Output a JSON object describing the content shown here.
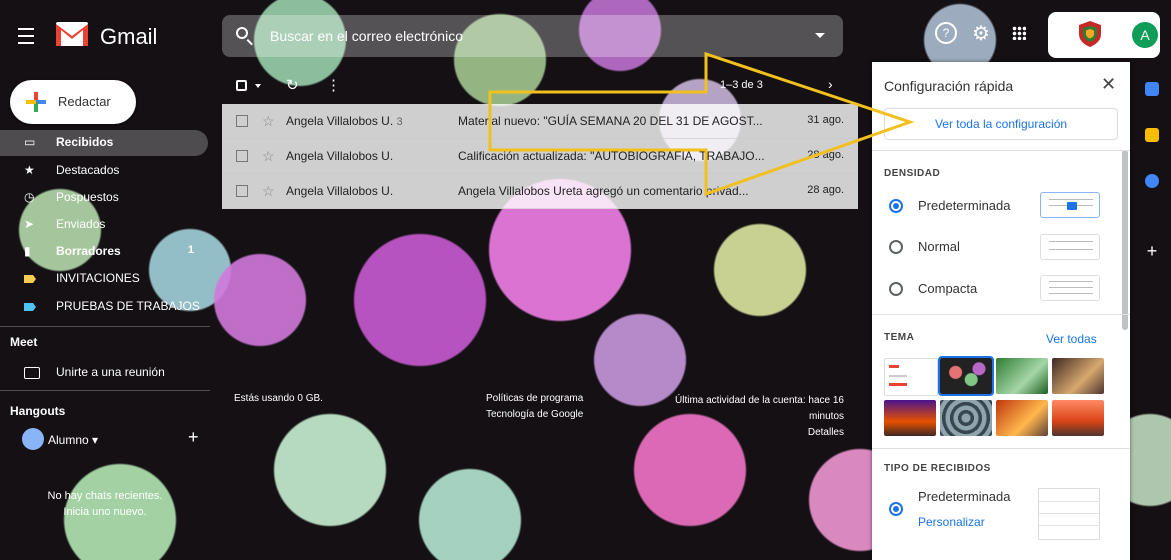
{
  "header": {
    "app_name": "Gmail",
    "search_placeholder": "Buscar en el correo electrónico",
    "avatar_letter": "A"
  },
  "sidebar": {
    "compose_label": "Redactar",
    "items": [
      {
        "label": "Recibidos",
        "bold": true,
        "icon": "inbox-icon"
      },
      {
        "label": "Destacados",
        "bold": false,
        "icon": "star-icon"
      },
      {
        "label": "Pospuestos",
        "bold": false,
        "icon": "clock-icon"
      },
      {
        "label": "Enviados",
        "bold": false,
        "icon": "send-icon"
      },
      {
        "label": "Borradores",
        "bold": true,
        "icon": "draft-icon",
        "count": "1"
      },
      {
        "label": "INVITACIONES",
        "bold": false,
        "icon": "label-icon"
      },
      {
        "label": "PRUEBAS DE TRABAJOS",
        "bold": false,
        "icon": "label-icon"
      }
    ],
    "meet_title": "Meet",
    "meet_join": "Unirte a una reunión",
    "hangouts_title": "Hangouts",
    "hangouts_user": "Alumno",
    "no_chats_line1": "No hay chats recientes.",
    "no_chats_line2": "Inicia uno nuevo."
  },
  "toolbar": {
    "range": "1–3 de 3"
  },
  "emails": [
    {
      "from": "Angela Villalobos U.",
      "count": "3",
      "subject": "Material nuevo: \"GUÍA SEMANA 20 DEL 31 DE AGOST...",
      "date": "31 ago."
    },
    {
      "from": "Angela Villalobos U.",
      "count": "",
      "subject": "Calificación actualizada: \"AUTOBIOGRAFÍA, TRABAJO...",
      "date": "28 ago."
    },
    {
      "from": "Angela Villalobos U.",
      "count": "",
      "subject": "Angela Villalobos Ureta agregó un comentario privad...",
      "date": "28 ago."
    }
  ],
  "footer": {
    "storage": "Estás usando 0 GB.",
    "policies": "Políticas de programa",
    "tech": "Tecnología de Google",
    "activity_line1": "Última actividad de la cuenta: hace 16",
    "activity_line2": "minutos",
    "details": "Detalles"
  },
  "quick_settings": {
    "title": "Configuración rápida",
    "all_settings": "Ver toda la configuración",
    "density_title": "DENSIDAD",
    "density_options": [
      "Predeterminada",
      "Normal",
      "Compacta"
    ],
    "density_selected": "Predeterminada",
    "theme_title": "TEMA",
    "theme_see_all": "Ver todas",
    "inbox_type_title": "TIPO DE RECIBIDOS",
    "inbox_option": "Predeterminada",
    "customize": "Personalizar"
  },
  "colors": {
    "accent": "#1a73e8",
    "gmail_red": "#ea4335",
    "highlight_arrow": "#f2c01e",
    "avatar_bg": "#0f9d58"
  }
}
